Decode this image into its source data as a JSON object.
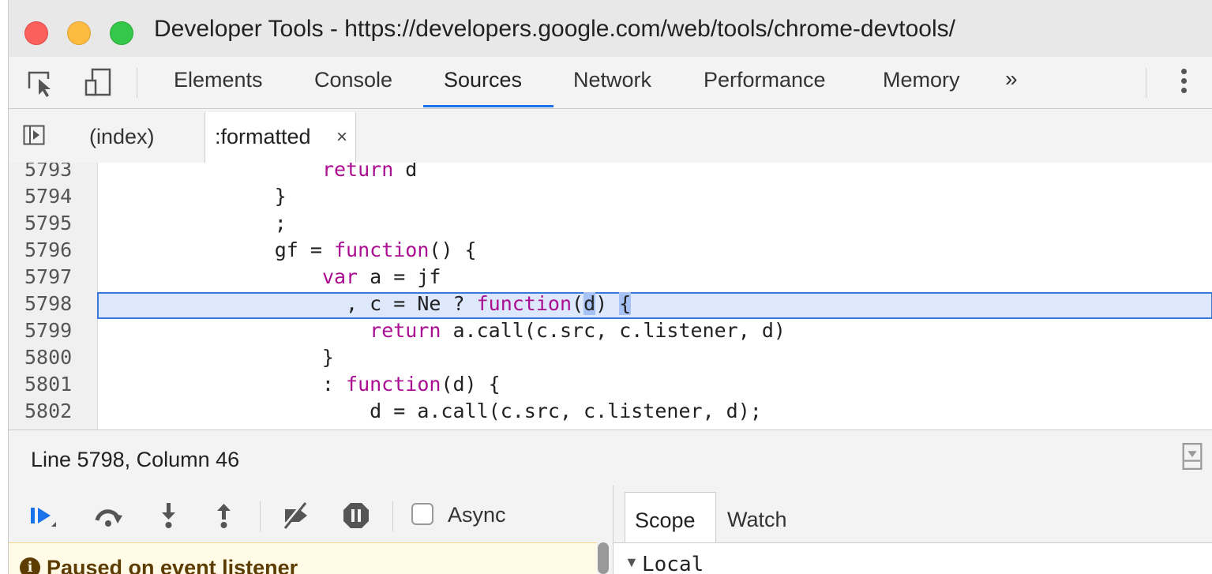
{
  "window": {
    "title": "Developer Tools - https://developers.google.com/web/tools/chrome-devtools/"
  },
  "toolbar": {
    "tabs": [
      {
        "label": "Elements"
      },
      {
        "label": "Console"
      },
      {
        "label": "Sources"
      },
      {
        "label": "Network"
      },
      {
        "label": "Performance"
      },
      {
        "label": "Memory"
      }
    ],
    "more": "»",
    "active_tab": "Sources"
  },
  "file_tabs": {
    "items": [
      {
        "label": "(index)"
      },
      {
        "label": ":formatted"
      }
    ],
    "close": "×"
  },
  "editor": {
    "lines": [
      {
        "num": "5793",
        "code": "                      return d"
      },
      {
        "num": "5794",
        "code": "                  }"
      },
      {
        "num": "5795",
        "code": "                  ;"
      },
      {
        "num": "5796",
        "code": "                  gf = function() {"
      },
      {
        "num": "5797",
        "code": "                      var a = jf"
      },
      {
        "num": "5798",
        "code": "                        , c = Ne ? function(d) {"
      },
      {
        "num": "5799",
        "code": "                          return a.call(c.src, c.listener, d)"
      },
      {
        "num": "5800",
        "code": "                      }"
      },
      {
        "num": "5801",
        "code": "                      : function(d) {"
      },
      {
        "num": "5802",
        "code": "                          d = a.call(c.src, c.listener, d);"
      }
    ],
    "highlighted_line": "5798"
  },
  "status": {
    "position": "Line 5798, Column 46"
  },
  "debugger": {
    "async_label": "Async",
    "paused_message": "Paused on event listener",
    "sidebar_tabs": [
      {
        "label": "Scope"
      },
      {
        "label": "Watch"
      }
    ],
    "scope_local": "Local"
  }
}
